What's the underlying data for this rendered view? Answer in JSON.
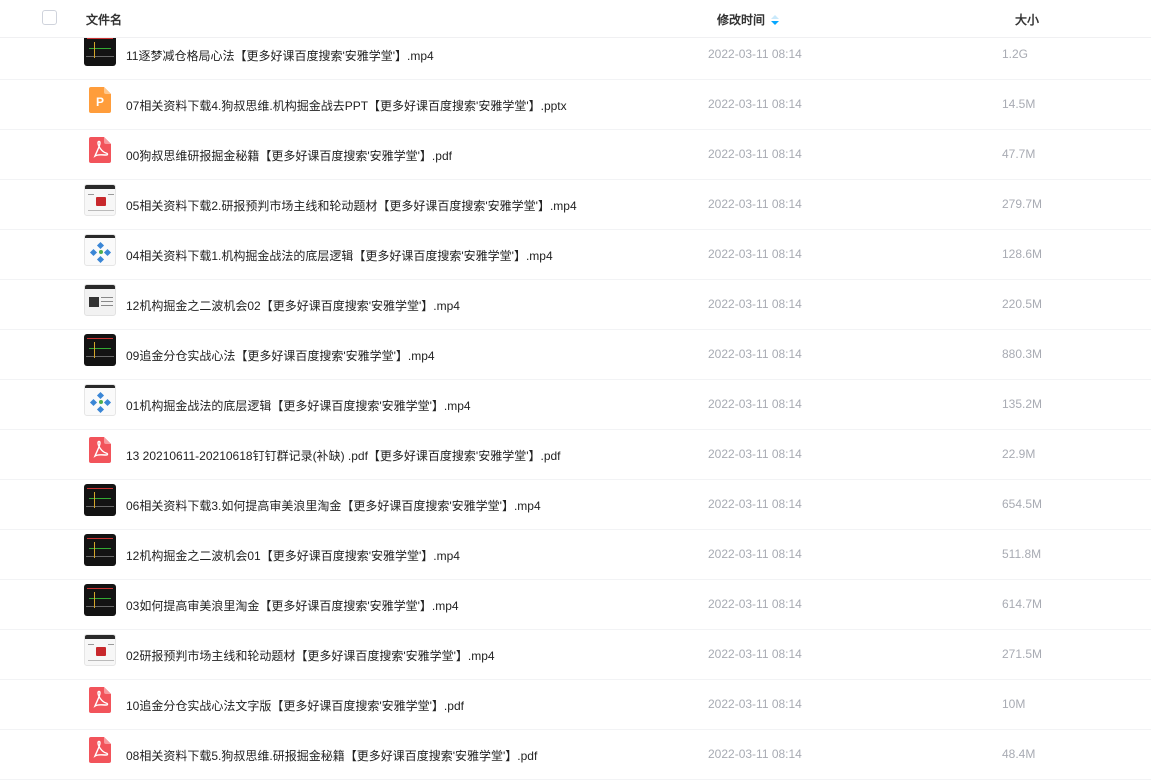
{
  "header": {
    "name_label": "文件名",
    "time_label": "修改时间",
    "size_label": "大小",
    "sort_color": "#06a7ff"
  },
  "files": [
    {
      "name": "11逐梦减仓格局心法【更多好课百度搜索'安雅学堂'】.mp4",
      "time": "2022-03-11 08:14",
      "size": "1.2G",
      "icon": "video-chart"
    },
    {
      "name": "07相关资料下载4.狗叔思维.机构掘金战去PPT【更多好课百度搜索'安雅学堂'】.pptx",
      "time": "2022-03-11 08:14",
      "size": "14.5M",
      "icon": "ppt-icon"
    },
    {
      "name": "00狗叔思维研报掘金秘籍【更多好课百度搜索'安雅学堂'】.pdf",
      "time": "2022-03-11 08:14",
      "size": "47.7M",
      "icon": "pdf-icon"
    },
    {
      "name": "05相关资料下载2.研报预判市场主线和轮动题材【更多好课百度搜索'安雅学堂'】.mp4",
      "time": "2022-03-11 08:14",
      "size": "279.7M",
      "icon": "video-doc"
    },
    {
      "name": "04相关资料下载1.机构掘金战法的底层逻辑【更多好课百度搜索'安雅学堂'】.mp4",
      "time": "2022-03-11 08:14",
      "size": "128.6M",
      "icon": "video-mind"
    },
    {
      "name": "12机构掘金之二波机会02【更多好课百度搜索'安雅学堂'】.mp4",
      "time": "2022-03-11 08:14",
      "size": "220.5M",
      "icon": "video-screen"
    },
    {
      "name": "09追金分仓实战心法【更多好课百度搜索'安雅学堂'】.mp4",
      "time": "2022-03-11 08:14",
      "size": "880.3M",
      "icon": "video-chart"
    },
    {
      "name": "01机构掘金战法的底层逻辑【更多好课百度搜索'安雅学堂'】.mp4",
      "time": "2022-03-11 08:14",
      "size": "135.2M",
      "icon": "video-mind"
    },
    {
      "name": "13 20210611-20210618钉钉群记录(补缺) .pdf【更多好课百度搜索'安雅学堂'】.pdf",
      "time": "2022-03-11 08:14",
      "size": "22.9M",
      "icon": "pdf-icon"
    },
    {
      "name": "06相关资料下载3.如何提高审美浪里淘金【更多好课百度搜索'安雅学堂'】.mp4",
      "time": "2022-03-11 08:14",
      "size": "654.5M",
      "icon": "video-chart"
    },
    {
      "name": "12机构掘金之二波机会01【更多好课百度搜索'安雅学堂'】.mp4",
      "time": "2022-03-11 08:14",
      "size": "511.8M",
      "icon": "video-chart"
    },
    {
      "name": "03如何提高审美浪里淘金【更多好课百度搜索'安雅学堂'】.mp4",
      "time": "2022-03-11 08:14",
      "size": "614.7M",
      "icon": "video-chart"
    },
    {
      "name": "02研报预判市场主线和轮动题材【更多好课百度搜索'安雅学堂'】.mp4",
      "time": "2022-03-11 08:14",
      "size": "271.5M",
      "icon": "video-doc"
    },
    {
      "name": "10追金分仓实战心法文字版【更多好课百度搜索'安雅学堂'】.pdf",
      "time": "2022-03-11 08:14",
      "size": "10M",
      "icon": "pdf-icon"
    },
    {
      "name": "08相关资料下载5.狗叔思维.研报掘金秘籍【更多好课百度搜索'安雅学堂'】.pdf",
      "time": "2022-03-11 08:14",
      "size": "48.4M",
      "icon": "pdf-icon"
    }
  ]
}
